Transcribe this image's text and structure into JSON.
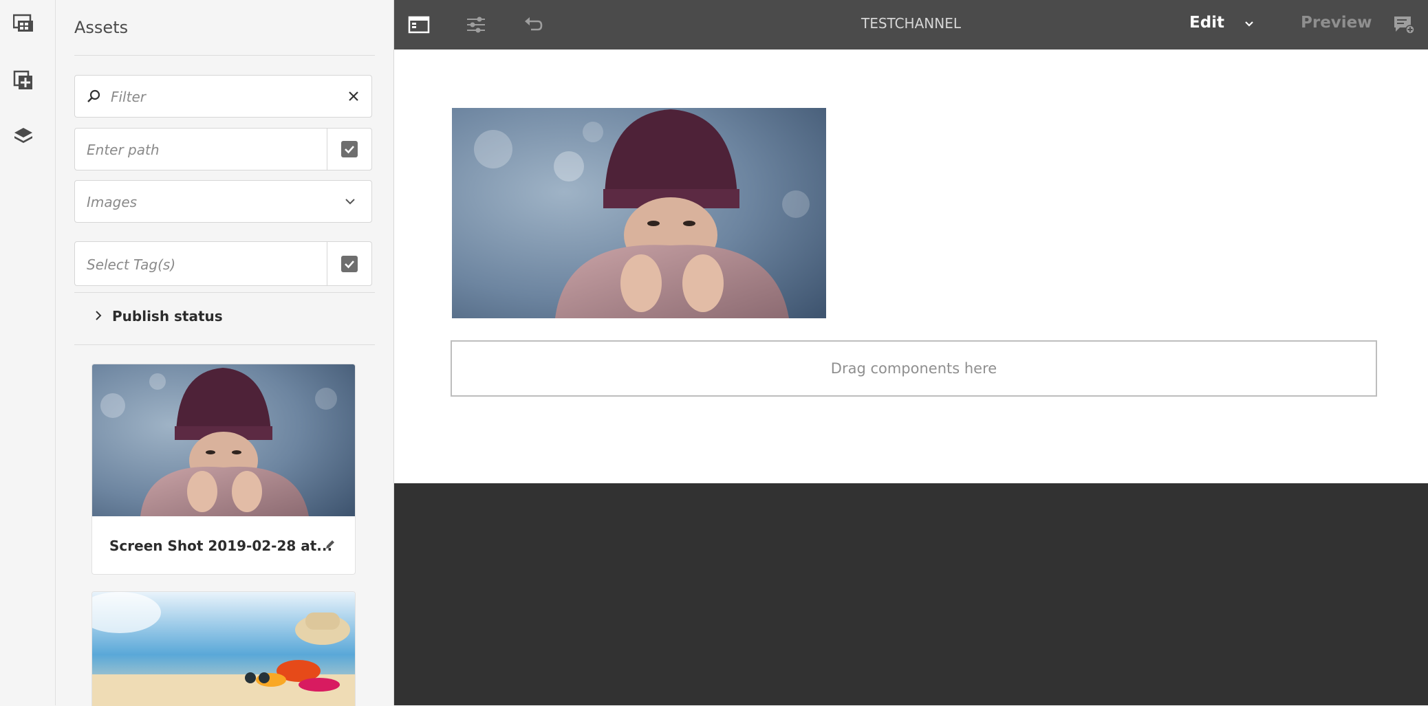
{
  "rail": {
    "items": [
      {
        "icon": "asset-finder-icon"
      },
      {
        "icon": "add-component-icon"
      },
      {
        "icon": "layers-icon"
      }
    ]
  },
  "panel": {
    "title": "Assets",
    "filter": {
      "placeholder": "Filter"
    },
    "path": {
      "placeholder": "Enter path"
    },
    "type": {
      "value": "Images"
    },
    "tags": {
      "placeholder": "Select Tag(s)"
    },
    "publish_status": "Publish status",
    "cards": [
      {
        "title": "Screen Shot 2019-02-28 at..."
      },
      {
        "title": ""
      }
    ]
  },
  "toolbar": {
    "title": "TESTCHANNEL",
    "mode": "Edit",
    "preview": "Preview"
  },
  "canvas": {
    "dropzone_text": "Drag components here"
  },
  "colors": {
    "toolbar": "#4b4b4b",
    "panel": "#f5f5f5",
    "canvas_dark": "#323232"
  }
}
